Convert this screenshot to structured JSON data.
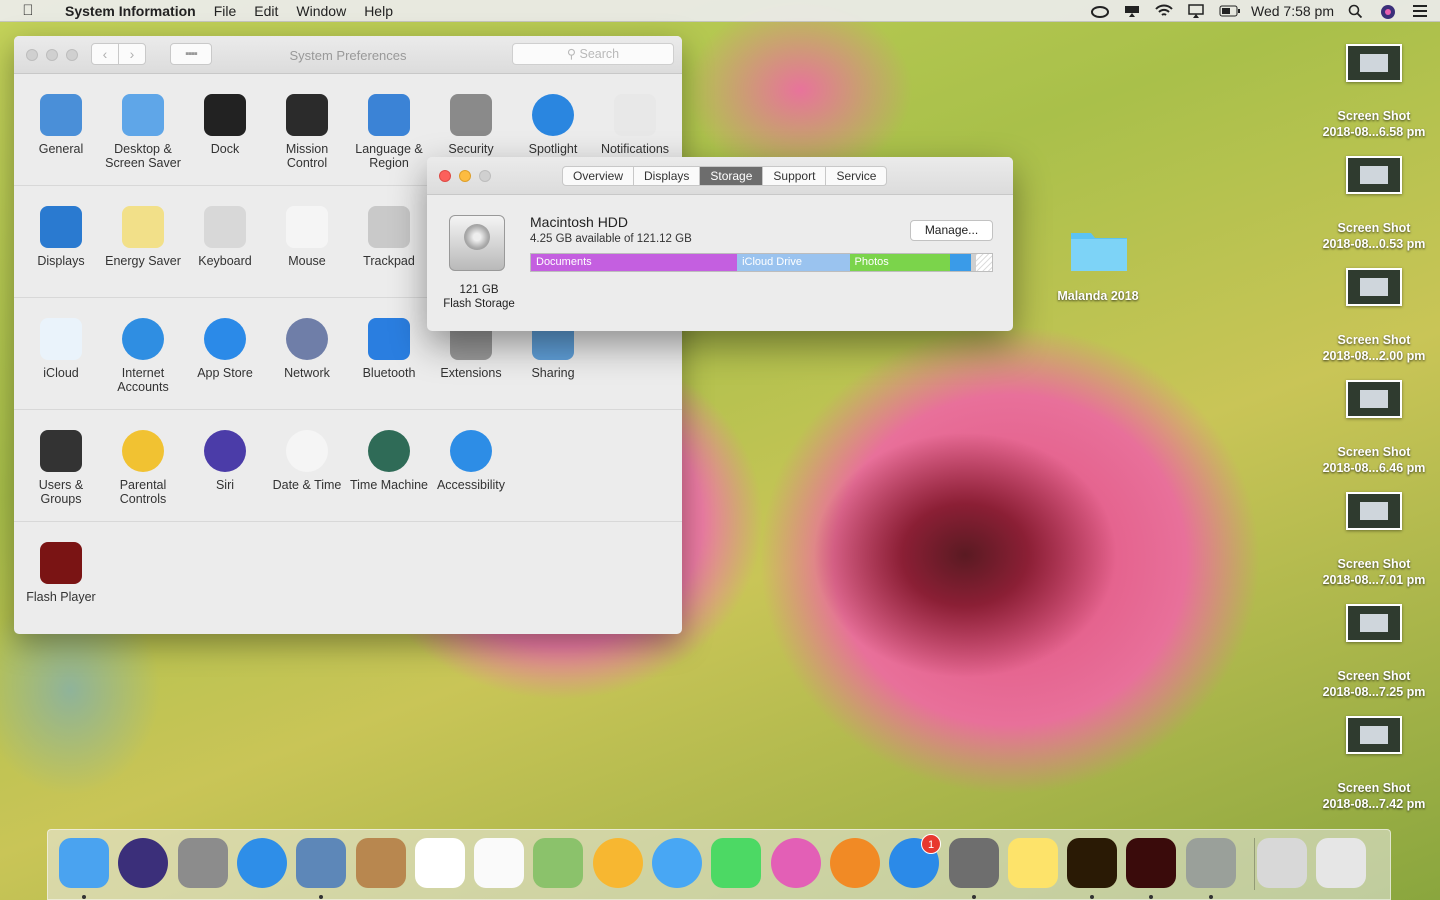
{
  "menubar": {
    "app": "System Information",
    "items": [
      "File",
      "Edit",
      "Window",
      "Help"
    ],
    "clock": "Wed 7:58 pm",
    "icons": [
      "creative-cloud-icon",
      "airplay-icon",
      "wifi-icon",
      "airplay-display-icon",
      "battery-icon",
      "spotlight-icon",
      "siri-icon",
      "control-center-icon"
    ]
  },
  "prefs": {
    "title": "System Preferences",
    "search_placeholder": "Search",
    "rows": [
      [
        {
          "label": "General",
          "icon": "general-icon",
          "color": "#4a8fd8"
        },
        {
          "label": "Desktop & Screen Saver",
          "icon": "desktop-icon",
          "color": "#5fa6e8"
        },
        {
          "label": "Dock",
          "icon": "dock-icon",
          "color": "#222222"
        },
        {
          "label": "Mission Control",
          "icon": "mission-control-icon",
          "color": "#2b2b2b"
        },
        {
          "label": "Language & Region",
          "icon": "flag-icon",
          "color": "#3b83d6"
        },
        {
          "label": "Security",
          "icon": "security-icon",
          "color": "#8a8a8a"
        },
        {
          "label": "Spotlight",
          "icon": "spotlight-icon",
          "color": "#2a86e0"
        },
        {
          "label": "Notifications",
          "icon": "notifications-icon",
          "color": "#e8e8e8"
        }
      ],
      [
        {
          "label": "Displays",
          "icon": "displays-icon",
          "color": "#2a7ad0"
        },
        {
          "label": "Energy Saver",
          "icon": "bulb-icon",
          "color": "#f2e089"
        },
        {
          "label": "Keyboard",
          "icon": "keyboard-icon",
          "color": "#d8d8d8"
        },
        {
          "label": "Mouse",
          "icon": "mouse-icon",
          "color": "#f5f5f5"
        },
        {
          "label": "Trackpad",
          "icon": "trackpad-icon",
          "color": "#c9c9c9"
        }
      ],
      [
        {
          "label": "iCloud",
          "icon": "icloud-icon",
          "color": "#eaf3fb"
        },
        {
          "label": "Internet Accounts",
          "icon": "at-icon",
          "color": "#2f8ee2"
        },
        {
          "label": "App Store",
          "icon": "app-store-icon",
          "color": "#2b8ae8"
        },
        {
          "label": "Network",
          "icon": "network-icon",
          "color": "#6f7ea8"
        },
        {
          "label": "Bluetooth",
          "icon": "bluetooth-icon",
          "color": "#2a7ee0"
        },
        {
          "label": "Extensions",
          "icon": "extensions-icon",
          "color": "#9a9a9a"
        },
        {
          "label": "Sharing",
          "icon": "sharing-icon",
          "color": "#5f9fd8"
        }
      ],
      [
        {
          "label": "Users & Groups",
          "icon": "users-icon",
          "color": "#333333"
        },
        {
          "label": "Parental Controls",
          "icon": "parental-icon",
          "color": "#f1c232"
        },
        {
          "label": "Siri",
          "icon": "siri-icon",
          "color": "#4b3ca8"
        },
        {
          "label": "Date & Time",
          "icon": "clock-icon",
          "color": "#f5f5f5"
        },
        {
          "label": "Time Machine",
          "icon": "time-machine-icon",
          "color": "#2f6b57"
        },
        {
          "label": "Accessibility",
          "icon": "accessibility-icon",
          "color": "#2d8de6"
        }
      ],
      [
        {
          "label": "Flash Player",
          "icon": "flash-icon",
          "color": "#7a1414"
        }
      ]
    ]
  },
  "info": {
    "tabs": [
      "Overview",
      "Displays",
      "Storage",
      "Support",
      "Service"
    ],
    "active_tab": "Storage",
    "disk_name": "Macintosh HDD",
    "disk_free": "4.25 GB available of 121.12 GB",
    "capacity": "121 GB",
    "kind": "Flash Storage",
    "manage_label": "Manage...",
    "segments": [
      {
        "label": "Documents",
        "fraction": 0.447,
        "color": "#c45fe0"
      },
      {
        "label": "iCloud Drive",
        "fraction": 0.244,
        "color": "#9ac3ef"
      },
      {
        "label": "Photos",
        "fraction": 0.218,
        "color": "#7bd44b"
      },
      {
        "label": "",
        "fraction": 0.045,
        "color": "#3a9be8"
      },
      {
        "label": "",
        "fraction": 0.008,
        "color": "#cfcfcf"
      }
    ]
  },
  "desktop": {
    "folder": "Malanda 2018",
    "screenshots": [
      {
        "l1": "Screen Shot",
        "l2": "2018-08...6.58 pm"
      },
      {
        "l1": "Screen Shot",
        "l2": "2018-08...0.53 pm"
      },
      {
        "l1": "Screen Shot",
        "l2": "2018-08...2.00 pm"
      },
      {
        "l1": "Screen Shot",
        "l2": "2018-08...6.46 pm"
      },
      {
        "l1": "Screen Shot",
        "l2": "2018-08...7.01 pm"
      },
      {
        "l1": "Screen Shot",
        "l2": "2018-08...7.25 pm"
      },
      {
        "l1": "Screen Shot",
        "l2": "2018-08...7.42 pm"
      }
    ]
  },
  "dock": {
    "items": [
      {
        "name": "finder-icon",
        "color": "#4aa3f0",
        "running": true
      },
      {
        "name": "siri-icon",
        "color": "#3b2f7a",
        "running": false
      },
      {
        "name": "launchpad-icon",
        "color": "#8c8c8c",
        "running": false
      },
      {
        "name": "safari-icon",
        "color": "#2e8ee8",
        "running": false
      },
      {
        "name": "preview-icon",
        "color": "#5d87b8",
        "running": true
      },
      {
        "name": "contacts-icon",
        "color": "#b8874f",
        "running": false
      },
      {
        "name": "calendar-icon",
        "color": "#ffffff",
        "running": false
      },
      {
        "name": "reminders-icon",
        "color": "#fafafa",
        "running": false
      },
      {
        "name": "maps-icon",
        "color": "#8bc26b",
        "running": false
      },
      {
        "name": "photos-icon",
        "color": "#f7b731",
        "running": false
      },
      {
        "name": "messages-icon",
        "color": "#48a7f4",
        "running": false
      },
      {
        "name": "facetime-icon",
        "color": "#4cd964",
        "running": false
      },
      {
        "name": "itunes-icon",
        "color": "#e35fb6",
        "running": false
      },
      {
        "name": "ibooks-icon",
        "color": "#f18a25",
        "running": false
      },
      {
        "name": "app-store-icon",
        "color": "#2b8ae8",
        "running": false
      },
      {
        "name": "system-preferences-icon",
        "color": "#6e6e6e",
        "running": true
      },
      {
        "name": "notes-icon",
        "color": "#fde36a",
        "running": false
      },
      {
        "name": "bridge-icon",
        "color": "#2a1a05",
        "running": true
      },
      {
        "name": "acrobat-icon",
        "color": "#3a0b0b",
        "running": true
      },
      {
        "name": "system-information-icon",
        "color": "#9aa09a",
        "running": true
      },
      {
        "name": "downloads-stack-icon",
        "color": "#d8d8d8",
        "running": false
      },
      {
        "name": "trash-icon",
        "color": "#e6e6e6",
        "running": false
      }
    ],
    "badge": "1"
  },
  "accent_colors": {
    "close": "#fc605b",
    "minimize": "#fdbc40"
  }
}
